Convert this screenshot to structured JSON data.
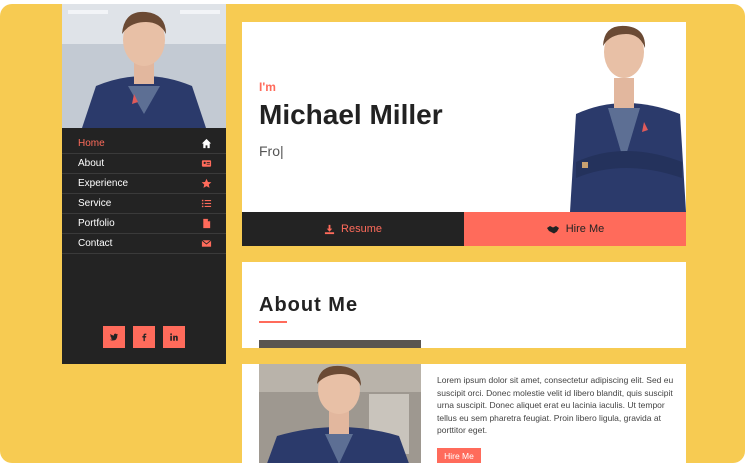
{
  "sidebar": {
    "nav": [
      {
        "label": "Home",
        "icon": "home-icon"
      },
      {
        "label": "About",
        "icon": "id-card-icon"
      },
      {
        "label": "Experience",
        "icon": "star-icon"
      },
      {
        "label": "Service",
        "icon": "list-icon"
      },
      {
        "label": "Portfolio",
        "icon": "file-icon"
      },
      {
        "label": "Contact",
        "icon": "envelope-icon"
      }
    ],
    "social": [
      "twitter-icon",
      "facebook-icon",
      "linkedin-icon"
    ]
  },
  "hero": {
    "intro": "I'm",
    "name": "Michael Miller",
    "typed": "Fro|",
    "resume_label": "Resume",
    "hire_label": "Hire Me"
  },
  "about": {
    "title": "About Me",
    "paragraph": "Lorem ipsum dolor sit amet, consectetur adipiscing elit. Sed eu suscipit orci. Donec molestie velit id libero blandit, quis suscipit urna suscipit. Donec aliquet erat eu lacinia iaculis. Ut tempor tellus eu sem pharetra feugiat. Proin libero ligula, gravida at porttitor eget.",
    "hire_label": "Hire Me"
  },
  "colors": {
    "accent": "#ff6b5b",
    "background": "#f7cb52",
    "dark": "#232323"
  }
}
